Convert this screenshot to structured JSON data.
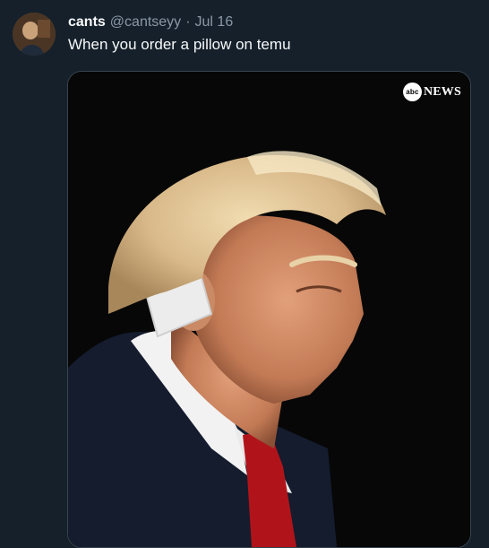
{
  "tweet": {
    "display_name": "cants",
    "handle": "@cantseyy",
    "separator": "·",
    "date": "Jul 16",
    "text": "When you order a pillow on temu"
  },
  "media": {
    "watermark_logo": "abc",
    "watermark_text": "NEWS",
    "description_icon": "photo-of-man-with-ear-bandage"
  },
  "colors": {
    "background": "#15202b",
    "text_primary": "#f7f9f9",
    "text_secondary": "#8b98a5",
    "media_border": "#38444d"
  }
}
